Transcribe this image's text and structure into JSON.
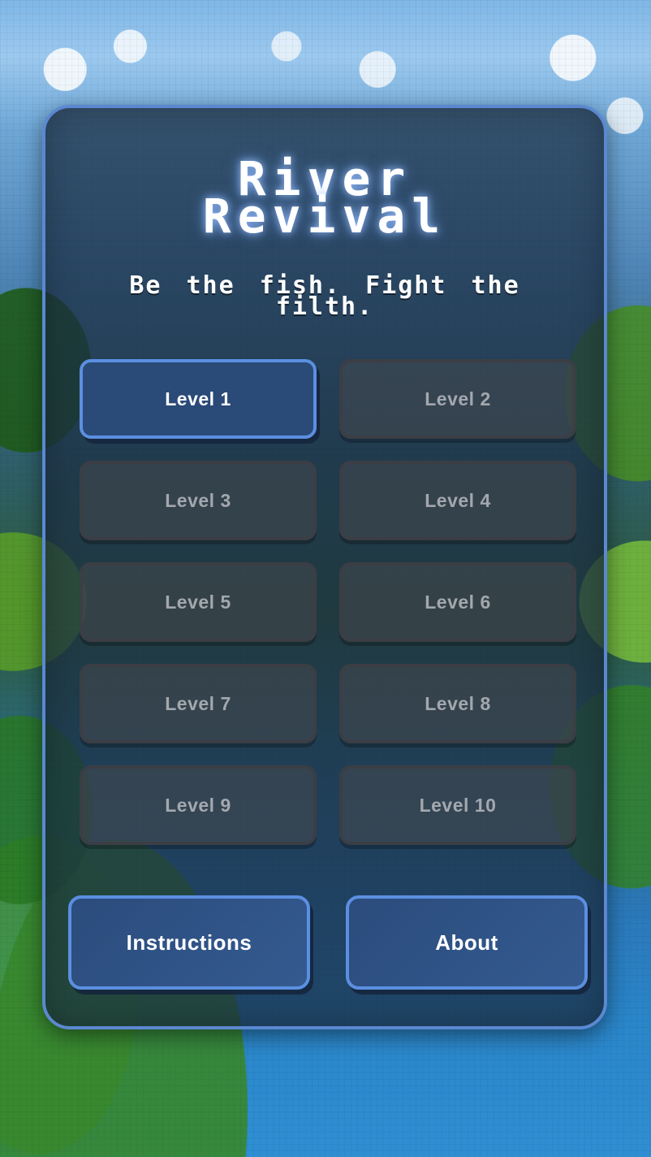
{
  "title": "River\nRevival",
  "tagline": "Be the fish. Fight the filth.",
  "levels": [
    {
      "label": "Level 1",
      "state": "unlocked"
    },
    {
      "label": "Level 2",
      "state": "locked"
    },
    {
      "label": "Level 3",
      "state": "locked"
    },
    {
      "label": "Level 4",
      "state": "locked"
    },
    {
      "label": "Level 5",
      "state": "locked"
    },
    {
      "label": "Level 6",
      "state": "locked"
    },
    {
      "label": "Level 7",
      "state": "locked"
    },
    {
      "label": "Level 8",
      "state": "locked"
    },
    {
      "label": "Level 9",
      "state": "locked"
    },
    {
      "label": "Level 10",
      "state": "locked"
    }
  ],
  "menu": {
    "instructions_label": "Instructions",
    "about_label": "About"
  },
  "colors": {
    "accent": "#5b8fe0",
    "button_fill": "#2a4a78",
    "panel": "#1c2e42"
  }
}
